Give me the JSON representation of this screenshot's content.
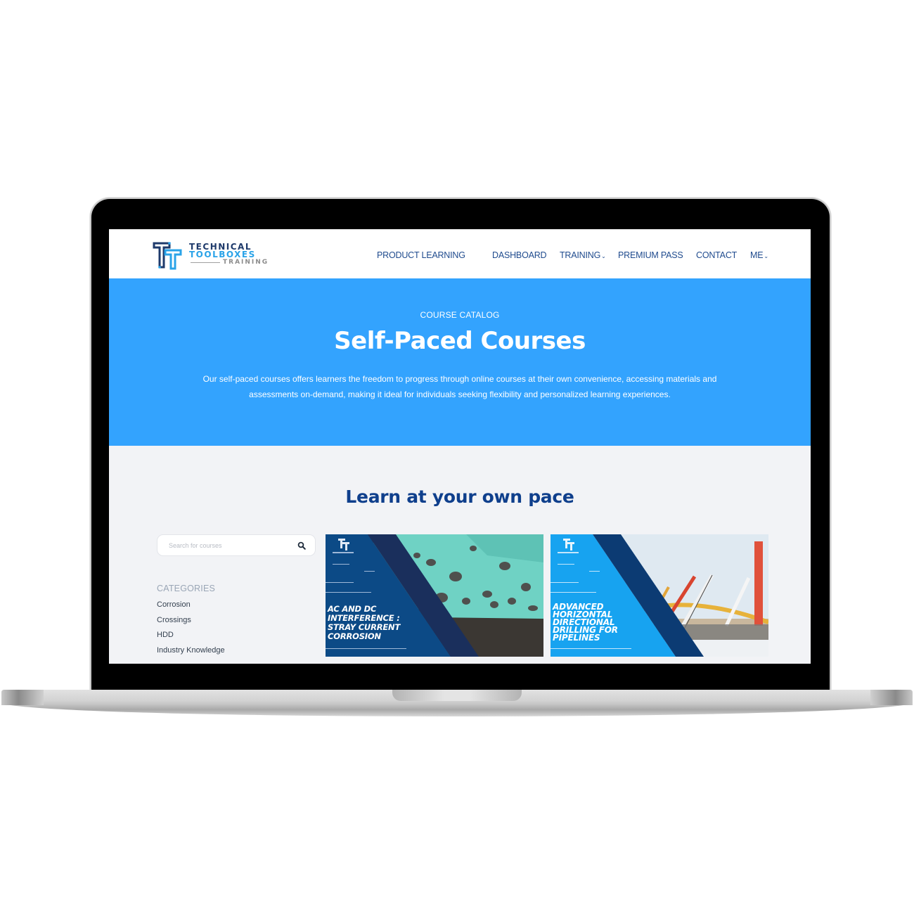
{
  "header": {
    "logo": {
      "line1": "TECHNICAL",
      "line2": "TOOLBOXES",
      "line3": "TRAINING"
    },
    "nav": [
      {
        "label": "PRODUCT LEARNING",
        "has_dropdown": false
      },
      {
        "label": "DASHBOARD",
        "has_dropdown": false
      },
      {
        "label": "TRAINING",
        "has_dropdown": true
      },
      {
        "label": "PREMIUM PASS",
        "has_dropdown": false
      },
      {
        "label": "CONTACT",
        "has_dropdown": false
      },
      {
        "label": "ME",
        "has_dropdown": true
      }
    ],
    "dropdown_caret": "⌄"
  },
  "hero": {
    "eyebrow": "COURSE CATALOG",
    "title": "Self-Paced Courses",
    "description": "Our self-paced courses offers learners the freedom to progress through online courses at their own convenience, accessing materials and assessments on-demand, making it ideal for individuals seeking flexibility and personalized learning experiences."
  },
  "main": {
    "section_title": "Learn at your own pace",
    "search": {
      "placeholder": "Search for courses",
      "value": "",
      "icon": "search-icon"
    },
    "categories": {
      "heading": "CATEGORIES",
      "items": [
        "Corrosion",
        "Crossings",
        "HDD",
        "Industry Knowledge"
      ]
    },
    "courses": [
      {
        "title": "AC and DC Interference : Stray Current Corrosion",
        "panel_color": "#0c4a86",
        "stripe_color": "#1a2f5c",
        "image_theme": "corroded pipe"
      },
      {
        "title": "Advanced Horizontal Directional Drilling for Pipelines",
        "panel_color": "#17a3f0",
        "stripe_color": "#0c3b73",
        "image_theme": "cranes lifting pipeline"
      }
    ]
  },
  "colors": {
    "hero_bg": "#33a3fe",
    "nav_text": "#1f4b8e",
    "section_title": "#0f3f8c",
    "page_bg": "#f2f3f6"
  }
}
